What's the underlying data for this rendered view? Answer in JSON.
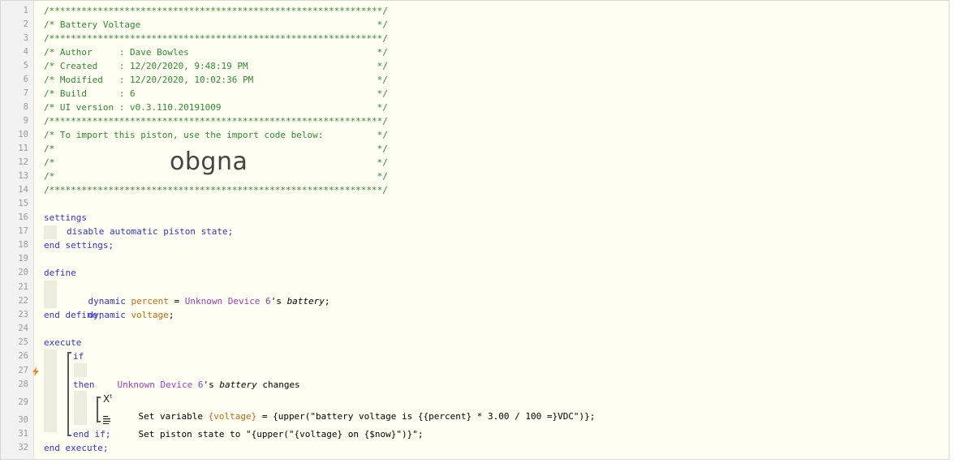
{
  "lines": [
    {
      "n": "1",
      "t": "/**************************************************************/"
    },
    {
      "n": "2",
      "t": "/* Battery Voltage                                            */"
    },
    {
      "n": "3",
      "t": "/**************************************************************/"
    },
    {
      "n": "4",
      "t": "/* Author     : Dave Bowles                                   */"
    },
    {
      "n": "5",
      "t": "/* Created    : 12/20/2020, 9:48:19 PM                        */"
    },
    {
      "n": "6",
      "t": "/* Modified   : 12/20/2020, 10:02:36 PM                       */"
    },
    {
      "n": "7",
      "t": "/* Build      : 6                                             */"
    },
    {
      "n": "8",
      "t": "/* UI version : v0.3.110.20191009                             */"
    },
    {
      "n": "9",
      "t": "/**************************************************************/"
    },
    {
      "n": "10",
      "t": "/* To import this piston, use the import code below:          */"
    },
    {
      "n": "11",
      "t": "/*                                                            */"
    },
    {
      "n": "12",
      "t": "/*                                                            */"
    },
    {
      "n": "13",
      "t": "/*                                                            */"
    },
    {
      "n": "14",
      "t": "/**************************************************************/"
    },
    {
      "n": "15",
      "t": ""
    },
    {
      "n": "16",
      "t": "settings"
    },
    {
      "n": "17",
      "t": "disable automatic piston state;"
    },
    {
      "n": "18",
      "t": "end settings;"
    },
    {
      "n": "19",
      "t": ""
    },
    {
      "n": "20",
      "t": "define"
    },
    {
      "n": "21",
      "t": ""
    },
    {
      "n": "22",
      "t": ""
    },
    {
      "n": "23",
      "t": "end define;"
    },
    {
      "n": "24",
      "t": ""
    },
    {
      "n": "25",
      "t": "execute"
    },
    {
      "n": "26",
      "t": "if"
    },
    {
      "n": "27",
      "t": ""
    },
    {
      "n": "28",
      "t": "then"
    },
    {
      "n": "29",
      "t": ""
    },
    {
      "n": "30",
      "t": ""
    },
    {
      "n": "31",
      "t": "end if;"
    },
    {
      "n": "32",
      "t": "end execute;"
    }
  ],
  "import_code": "obgna",
  "define_lines": {
    "percent": {
      "kw": "dynamic",
      "var": "percent",
      "eq": " = ",
      "dev": "Unknown Device 6",
      "poss": "'s ",
      "attr": "battery",
      "end": ";"
    },
    "voltage": {
      "kw": "dynamic",
      "var": "voltage",
      "end": ";"
    }
  },
  "condition": {
    "dev": "Unknown Device 6",
    "poss": "'s ",
    "attr": "battery",
    "verb": " changes"
  },
  "action1": {
    "icon": "X",
    "icon_sup": "t",
    "pre": "Set variable ",
    "var": "{voltage}",
    "rest": " = {upper(\"battery voltage is {{percent} * 3.00 / 100 =}VDC\")};"
  },
  "action2": {
    "pre": "Set piston state to ",
    "rest": "\"{upper(\"{voltage} on {$now}\")}\";"
  },
  "colors": {
    "comment": "#2e8b2e",
    "keyword": "#3333cc",
    "device": "#9b3cc8",
    "variable": "#c2690f",
    "trigger": "#ff7a1a"
  }
}
